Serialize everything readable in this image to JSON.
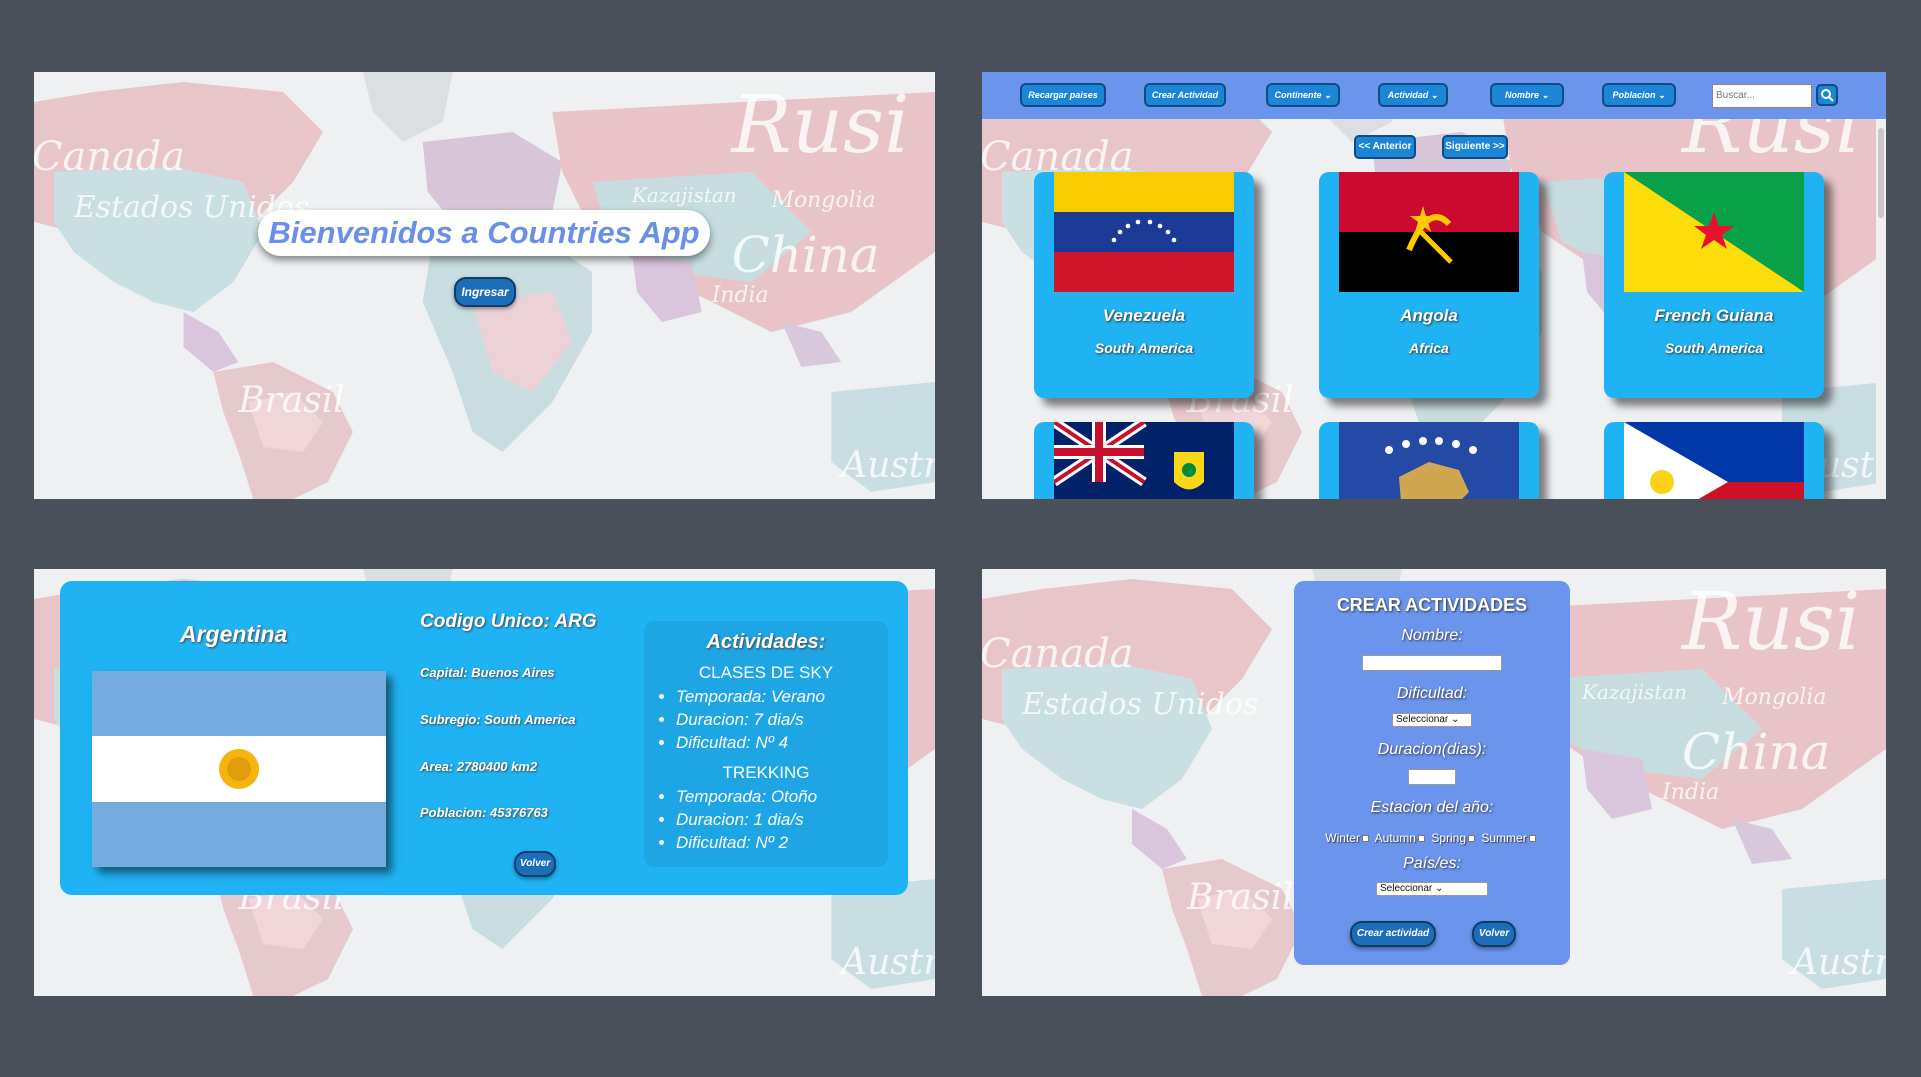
{
  "colors": {
    "background": "#4a5059",
    "navbar": "#6b94ec",
    "card": "#20b3f4",
    "button": "#1d85d6",
    "welcome_text": "#6a8fe6"
  },
  "map_labels": [
    "Canada",
    "Estados Unidos",
    "Brasil",
    "China",
    "Kazajistan",
    "Mongolia",
    "India",
    "Austr",
    "Rusi"
  ],
  "landing": {
    "title": "Bienvenidos a Countries App",
    "enter_button": "Ingresar"
  },
  "home": {
    "nav": {
      "reload": "Recargar paises",
      "create_activity": "Crear Actividad",
      "continent": "Continente",
      "activity": "Actividad",
      "name": "Nombre",
      "population": "Poblacion",
      "search_placeholder": "Buscar..."
    },
    "pager": {
      "prev": "<< Anterior",
      "next": "Siguiente >>"
    },
    "cards": [
      {
        "name": "Venezuela",
        "continent": "South America",
        "flag": "venezuela-flag"
      },
      {
        "name": "Angola",
        "continent": "Africa",
        "flag": "angola-flag"
      },
      {
        "name": "French Guiana",
        "continent": "South America",
        "flag": "french-guiana-flag"
      },
      {
        "name": "",
        "continent": "",
        "flag": "turks-and-caicos-flag"
      },
      {
        "name": "",
        "continent": "",
        "flag": "kosovo-flag"
      },
      {
        "name": "",
        "continent": "",
        "flag": "philippines-flag"
      }
    ]
  },
  "detail": {
    "name": "Argentina",
    "code": "Codigo Unico: ARG",
    "capital": "Capital: Buenos Aires",
    "subregion": "Subregio: South America",
    "area": "Area: 2780400 km2",
    "population": "Poblacion: 45376763",
    "back_button": "Volver",
    "activities_title": "Actividades:",
    "activities": [
      {
        "name": "CLASES DE SKY",
        "season": "Temporada: Verano",
        "duration": "Duracion: 7 dia/s",
        "difficulty": "Dificultad: Nº 4"
      },
      {
        "name": "TREKKING",
        "season": "Temporada: Otoño",
        "duration": "Duracion: 1 dia/s",
        "difficulty": "Dificultad: Nº 2"
      }
    ]
  },
  "create": {
    "title": "CREAR ACTIVIDADES",
    "name_label": "Nombre:",
    "difficulty_label": "Dificultad:",
    "difficulty_value": "Seleccionar",
    "duration_label": "Duracion(dias):",
    "season_label": "Estacion del año:",
    "seasons": [
      "Winter",
      "Autumn",
      "Spring",
      "Summer"
    ],
    "country_label": "País/es:",
    "country_value": "Seleccionar",
    "submit_button": "Crear actividad",
    "back_button": "Volver"
  }
}
